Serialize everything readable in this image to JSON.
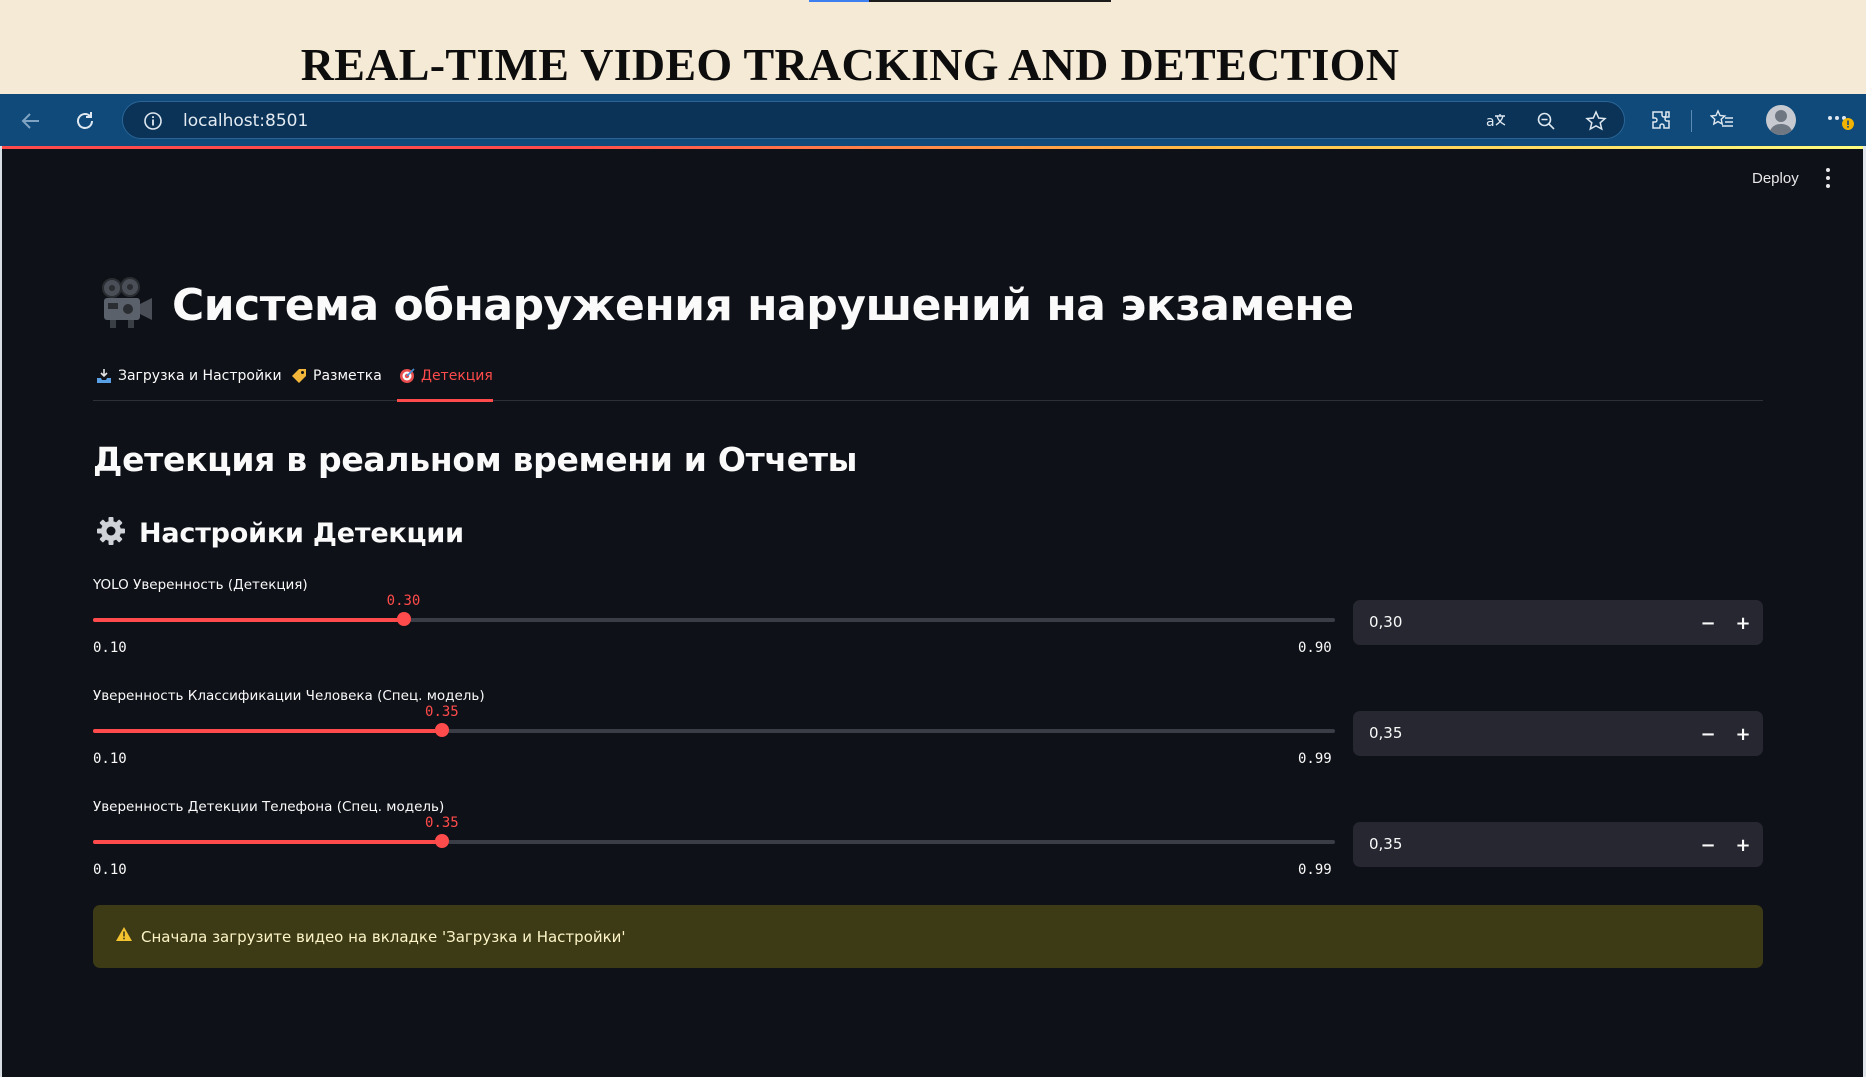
{
  "banner": {
    "title": "REAL-TIME VIDEO TRACKING AND DETECTION"
  },
  "browser": {
    "url": "localhost:8501",
    "icons": [
      "back-icon",
      "reload-icon",
      "info-icon",
      "translate-icon",
      "zoom-out-icon",
      "star-icon",
      "extensions-icon",
      "favorites-icon",
      "profile-icon",
      "more-icon"
    ]
  },
  "app": {
    "deploy_label": "Deploy",
    "title_icon": "movie-camera-icon",
    "title": "Система обнаружения нарушений на экзамене",
    "tabs": [
      {
        "label": "Загрузка и Настройки",
        "icon": "inbox-tray-icon",
        "active": false
      },
      {
        "label": "Разметка",
        "icon": "label-tag-icon",
        "active": false
      },
      {
        "label": "Детекция",
        "icon": "target-icon",
        "active": true
      }
    ],
    "section_title": "Детекция в реальном времени и Отчеты",
    "settings_icon": "gear-icon",
    "settings_title": "Настройки Детекции",
    "sliders": [
      {
        "label": "YOLO Уверенность (Детекция)",
        "value": 0.3,
        "value_text": "0.30",
        "min": 0.1,
        "max": 0.9,
        "min_text": "0.10",
        "max_text": "0.90",
        "input_text": "0,30"
      },
      {
        "label": "Уверенность Классификации Человека (Спец. модель)",
        "value": 0.35,
        "value_text": "0.35",
        "min": 0.1,
        "max": 0.99,
        "min_text": "0.10",
        "max_text": "0.99",
        "input_text": "0,35"
      },
      {
        "label": "Уверенность Детекции Телефона (Спец. модель)",
        "value": 0.35,
        "value_text": "0.35",
        "min": 0.1,
        "max": 0.99,
        "min_text": "0.10",
        "max_text": "0.99",
        "input_text": "0,35"
      }
    ],
    "stepper": {
      "minus": "−",
      "plus": "+"
    },
    "warning_icon": "warning-icon",
    "warning": "Сначала загрузите видео на вкладке 'Загрузка и Настройки'",
    "colors": {
      "accent": "#ff4b4b",
      "background": "#0e1117",
      "input_bg": "#262730",
      "warning_bg": "#3d3a16",
      "browser_bar": "#0f4a7a"
    }
  }
}
